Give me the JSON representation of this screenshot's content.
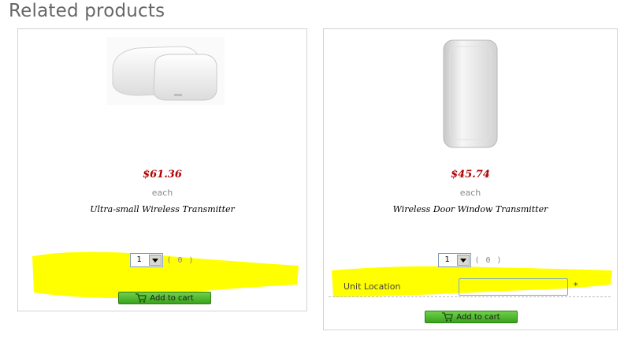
{
  "section": {
    "title": "Related products"
  },
  "products": [
    {
      "price": "$61.36",
      "unit": "each",
      "name": "Ultra-small Wireless Transmitter",
      "quantity": "1",
      "count": "( 0 )",
      "add_to_cart_label": "Add to cart"
    },
    {
      "price": "$45.74",
      "unit": "each",
      "name": "Wireless Door Window Transmitter",
      "quantity": "1",
      "count": "( 0 )",
      "add_to_cart_label": "Add to cart",
      "option": {
        "label": "Unit Location",
        "value": "",
        "required_marker": "*"
      }
    }
  ],
  "colors": {
    "highlight": "#ffff00",
    "price": "#b00000",
    "button": "#3aa21d"
  },
  "icons": {
    "dropdown": "chevron-down-icon",
    "cart": "cart-icon"
  }
}
